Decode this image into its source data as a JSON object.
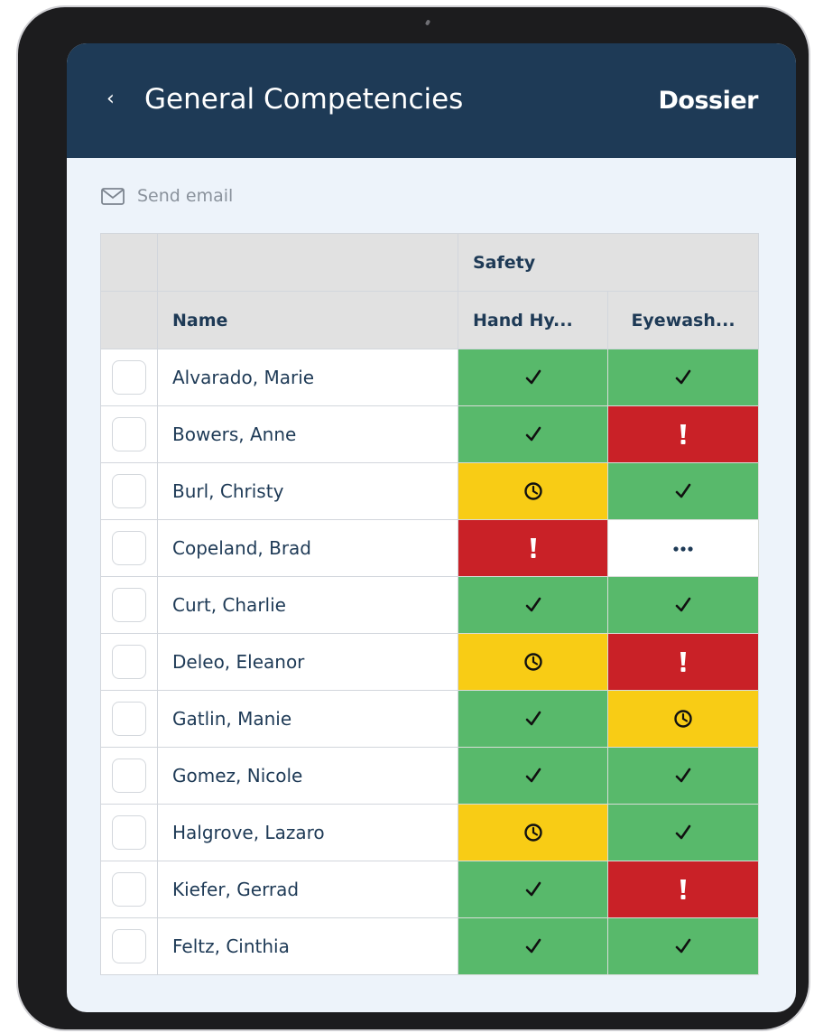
{
  "header": {
    "back_icon": "chevron-left-icon",
    "title": "General Competencies",
    "logo_text": "Dossier",
    "colors": {
      "bar": "#1e3a56",
      "text": "#ffffff"
    }
  },
  "toolbar": {
    "email_icon": "mail-icon",
    "send_email_label": "Send email"
  },
  "table": {
    "group_header": "Safety",
    "columns": [
      "Name",
      "Hand Hy...",
      "Eyewash..."
    ],
    "rows": [
      {
        "name": "Alvarado, Marie",
        "hand": "ok",
        "eye": "ok"
      },
      {
        "name": "Bowers, Anne",
        "hand": "ok",
        "eye": "alert"
      },
      {
        "name": "Burl, Christy",
        "hand": "pending",
        "eye": "ok"
      },
      {
        "name": "Copeland, Brad",
        "hand": "alert",
        "eye": "none"
      },
      {
        "name": "Curt, Charlie",
        "hand": "ok",
        "eye": "ok"
      },
      {
        "name": "Deleo, Eleanor",
        "hand": "pending",
        "eye": "alert"
      },
      {
        "name": "Gatlin, Manie",
        "hand": "ok",
        "eye": "pending"
      },
      {
        "name": "Gomez, Nicole",
        "hand": "ok",
        "eye": "ok"
      },
      {
        "name": "Halgrove, Lazaro",
        "hand": "pending",
        "eye": "ok"
      },
      {
        "name": "Kiefer, Gerrad",
        "hand": "ok",
        "eye": "alert"
      },
      {
        "name": "Feltz, Cinthia",
        "hand": "ok",
        "eye": "ok"
      }
    ],
    "status_colors": {
      "ok": "#58b96b",
      "alert": "#c92127",
      "pending": "#f8cc15",
      "none": "#ffffff"
    },
    "status_icons": {
      "ok": "check-icon",
      "alert": "exclamation-icon",
      "pending": "clock-icon",
      "none": "ellipsis-icon"
    }
  }
}
